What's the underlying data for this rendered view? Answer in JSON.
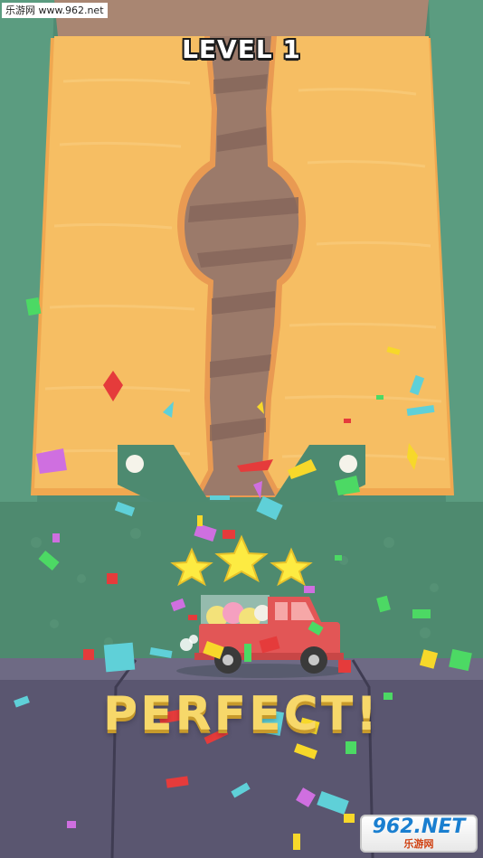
{
  "watermark_top": "乐游网 www.962.net",
  "level": {
    "label": "LEVEL 1"
  },
  "result": {
    "text": "PERFECT!",
    "stars_earned": 3,
    "stars_total": 3
  },
  "logo": {
    "main": "962.NET",
    "sub": "乐游网"
  },
  "icons": [
    "star-icon",
    "truck-icon",
    "confetti-piece-icon"
  ],
  "colors": {
    "sand": "#f6be63",
    "dug_channel": "#9b7a6a",
    "side_walls": "#5b9c80",
    "road": "#5a5670",
    "truck": "#e25656",
    "star": "#fdeb42",
    "perfect_text": "#f7d86a"
  }
}
